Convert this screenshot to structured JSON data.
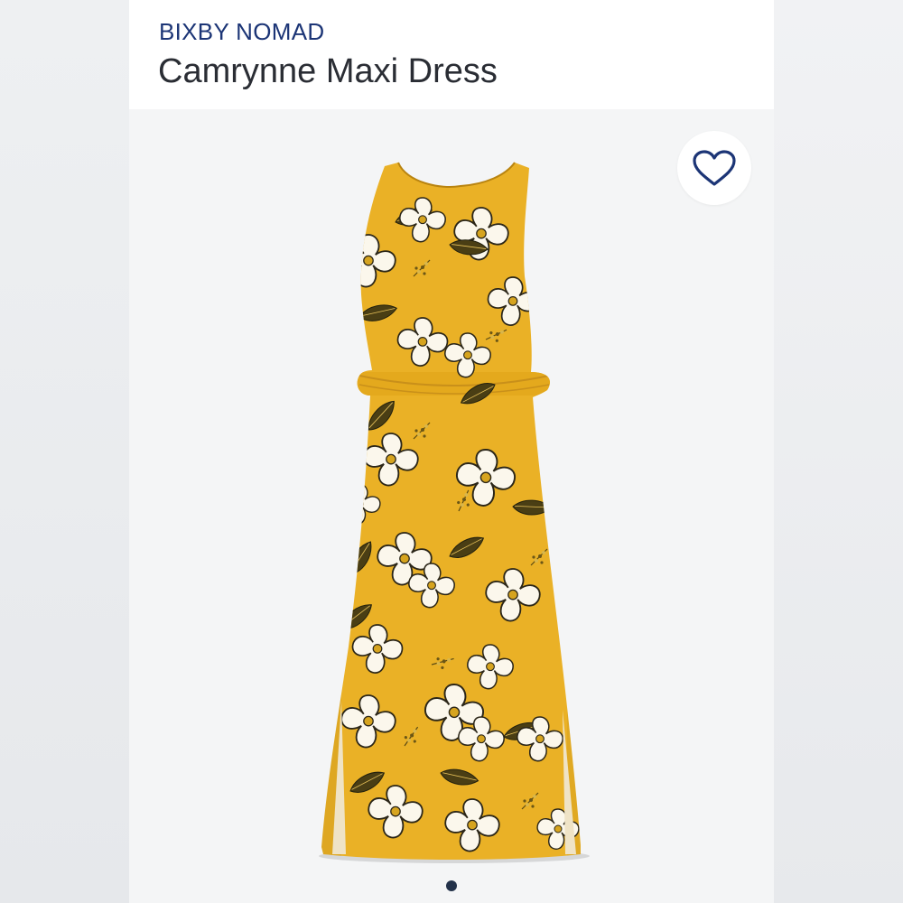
{
  "product": {
    "brand": "BIXBY NOMAD",
    "name": "Camrynne Maxi Dress"
  },
  "gallery": {
    "image_alt": "Camrynne Maxi Dress",
    "favorite_icon": "heart-outline-icon",
    "active_index": 1,
    "count": 1
  },
  "colors": {
    "brand_text": "#1c3576",
    "title_text": "#2a2d34",
    "dress_base": "#eab126",
    "dot_active": "#23324a"
  }
}
